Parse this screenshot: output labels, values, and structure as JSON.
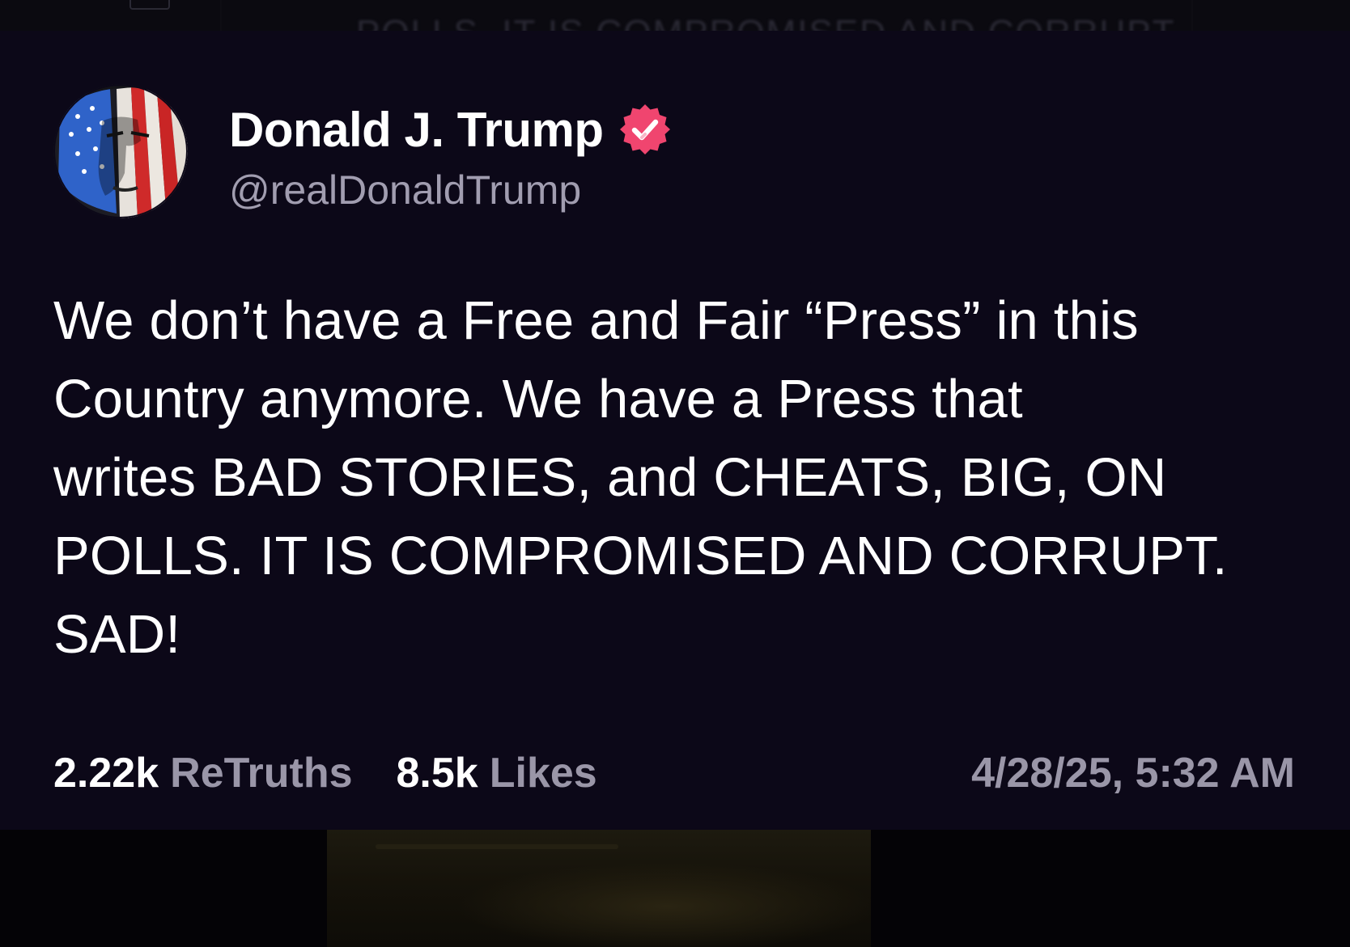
{
  "background": {
    "ghost_text": "POLLS. IT IS COMPROMISED AND CORRUPT."
  },
  "post": {
    "author": {
      "display_name": "Donald J. Trump",
      "handle": "@realDonaldTrump",
      "verified": true,
      "avatar_icon": "flag-painted-face-avatar",
      "verified_icon": "verified-badge-icon"
    },
    "text": "We don’t have a Free and Fair “Press” in this\nCountry anymore. We have a Press that\nwrites BAD STORIES, and CHEATS, BIG, ON\nPOLLS. IT IS COMPROMISED AND CORRUPT.\nSAD!",
    "retruths_count": "2.22k",
    "retruths_label": "ReTruths",
    "likes_count": "8.5k",
    "likes_label": "Likes",
    "timestamp": "4/28/25, 5:32 AM"
  },
  "colors": {
    "card_background": "#0c0818",
    "page_background": "#050409",
    "primary_text": "#ffffff",
    "secondary_text": "#9a96a8",
    "verified_badge": "#f0456f"
  }
}
